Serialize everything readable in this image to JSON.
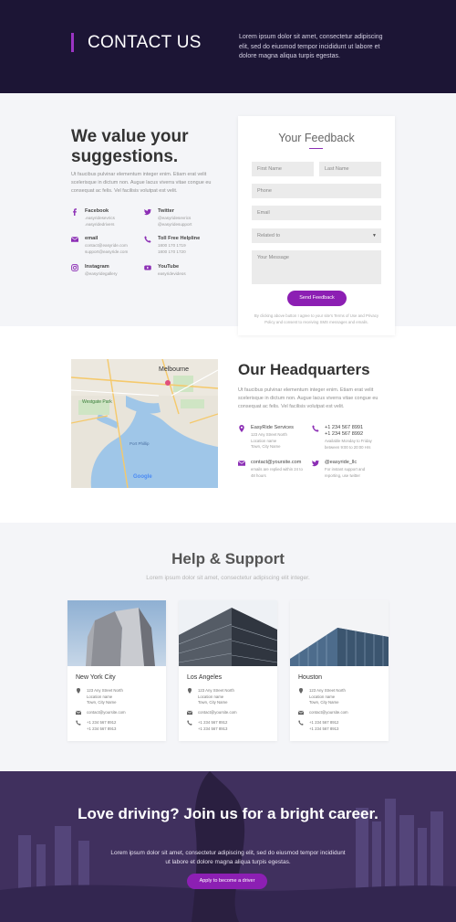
{
  "hero": {
    "title": "CONTACT US",
    "text": "Lorem ipsum dolor sit amet, consectetur adipiscing elit, sed do eiusmod tempor incididunt ut labore et dolore magna aliqua turpis egestas."
  },
  "suggestions": {
    "title": "We value your suggestions.",
    "text": "Ut faucibus pulvinar elementum integer enim. Etiam erat velit scelerisque in dictum non. Augue lacus viverra vitae congue eu consequat ac felis. Vel facilisis volutpat est velit.",
    "contacts": [
      {
        "icon": "facebook-icon",
        "label": "Facebook",
        "lines": [
          ".easyridesevrics",
          ".easyridedrivers"
        ]
      },
      {
        "icon": "twitter-icon",
        "label": "Twitter",
        "lines": [
          "@easyridesevrics",
          "@easyridesupport"
        ]
      },
      {
        "icon": "email-icon",
        "label": "email",
        "lines": [
          "contact@easyride.com",
          "support@easyride.com"
        ]
      },
      {
        "icon": "phone-icon",
        "label": "Toll Free Helpline",
        "lines": [
          "1800 170 1719",
          "1800 170 1720"
        ]
      },
      {
        "icon": "instagram-icon",
        "label": "Instagram",
        "lines": [
          "@easyridegallery"
        ]
      },
      {
        "icon": "youtube-icon",
        "label": "YouTube",
        "lines": [
          "easyridevideos"
        ]
      }
    ]
  },
  "form": {
    "title": "Your Feedback",
    "first_name": "First Name",
    "last_name": "Last Name",
    "phone": "Phone",
    "email": "Email",
    "related_to": "Related to",
    "message": "Your Message",
    "submit": "Send Feedback",
    "legal": "By clicking above button I agree to your site's Terms of Use and Privacy Policy and consent to receiving SMS messages and emails."
  },
  "headquarters": {
    "title": "Our Headquarters",
    "text": "Ut faucibus pulvinar elementum integer enim. Etiam erat velit scelerisque in dictum non. Augue lacus viverra vitae congue eu consequat ac felis. Vel facilisis volutpat est velit.",
    "map_labels": {
      "city": "Melbourne",
      "park": "Westgate Park",
      "bay": "Port Phillip",
      "google": "Google"
    },
    "items": [
      {
        "icon": "location-pin-icon",
        "label": "EasyRide Services",
        "lines": [
          "123 Any Street North",
          "Location name",
          "Town, City Name"
        ]
      },
      {
        "icon": "phone-icon",
        "label": "+1 234 567 8991",
        "label2": "+1 234 567 8992",
        "lines": [
          "Available Monday to Friday",
          "between 9:00 to 20:00 Hrs"
        ]
      },
      {
        "icon": "email-icon",
        "label": "contact@yoursite.com",
        "lines": [
          "emails are replied within 24 to",
          "48 hours"
        ]
      },
      {
        "icon": "twitter-icon",
        "label": "@easyride_llc",
        "lines": [
          "For instant support and",
          "reporting, use twitter"
        ]
      }
    ]
  },
  "help": {
    "title": "Help & Support",
    "subtitle": "Lorem ipsum dolor sit amet, consectetur adipiscing elit integer.",
    "cities": [
      {
        "name": "New York City",
        "address": [
          "123 Any Street North",
          "Location name",
          "Town, City Name"
        ],
        "email": "contact@yoursite.com",
        "phones": [
          "+1 234 567 8912",
          "+1 234 567 8913"
        ]
      },
      {
        "name": "Los Angeles",
        "address": [
          "123 Any Street North",
          "Location name",
          "Town, City Name"
        ],
        "email": "contact@yoursite.com",
        "phones": [
          "+1 234 567 8912",
          "+1 234 567 8913"
        ]
      },
      {
        "name": "Houston",
        "address": [
          "123 Any Street North",
          "Location name",
          "Town, City Name"
        ],
        "email": "contact@yoursite.com",
        "phones": [
          "+1 234 567 8912",
          "+1 234 567 8913"
        ]
      }
    ]
  },
  "career": {
    "title": "Love driving? Join us for a bright career.",
    "text": "Lorem ipsum dolor sit amet, consectetur adipiscing elit, sed do eiusmod tempor incididunt ut labore et dolore magna aliqua turpis egestas.",
    "button": "Apply to become a driver"
  },
  "colors": {
    "accent": "#8c1fb3",
    "hero_bg": "#1c1535",
    "section_bg": "#f4f5f8"
  }
}
